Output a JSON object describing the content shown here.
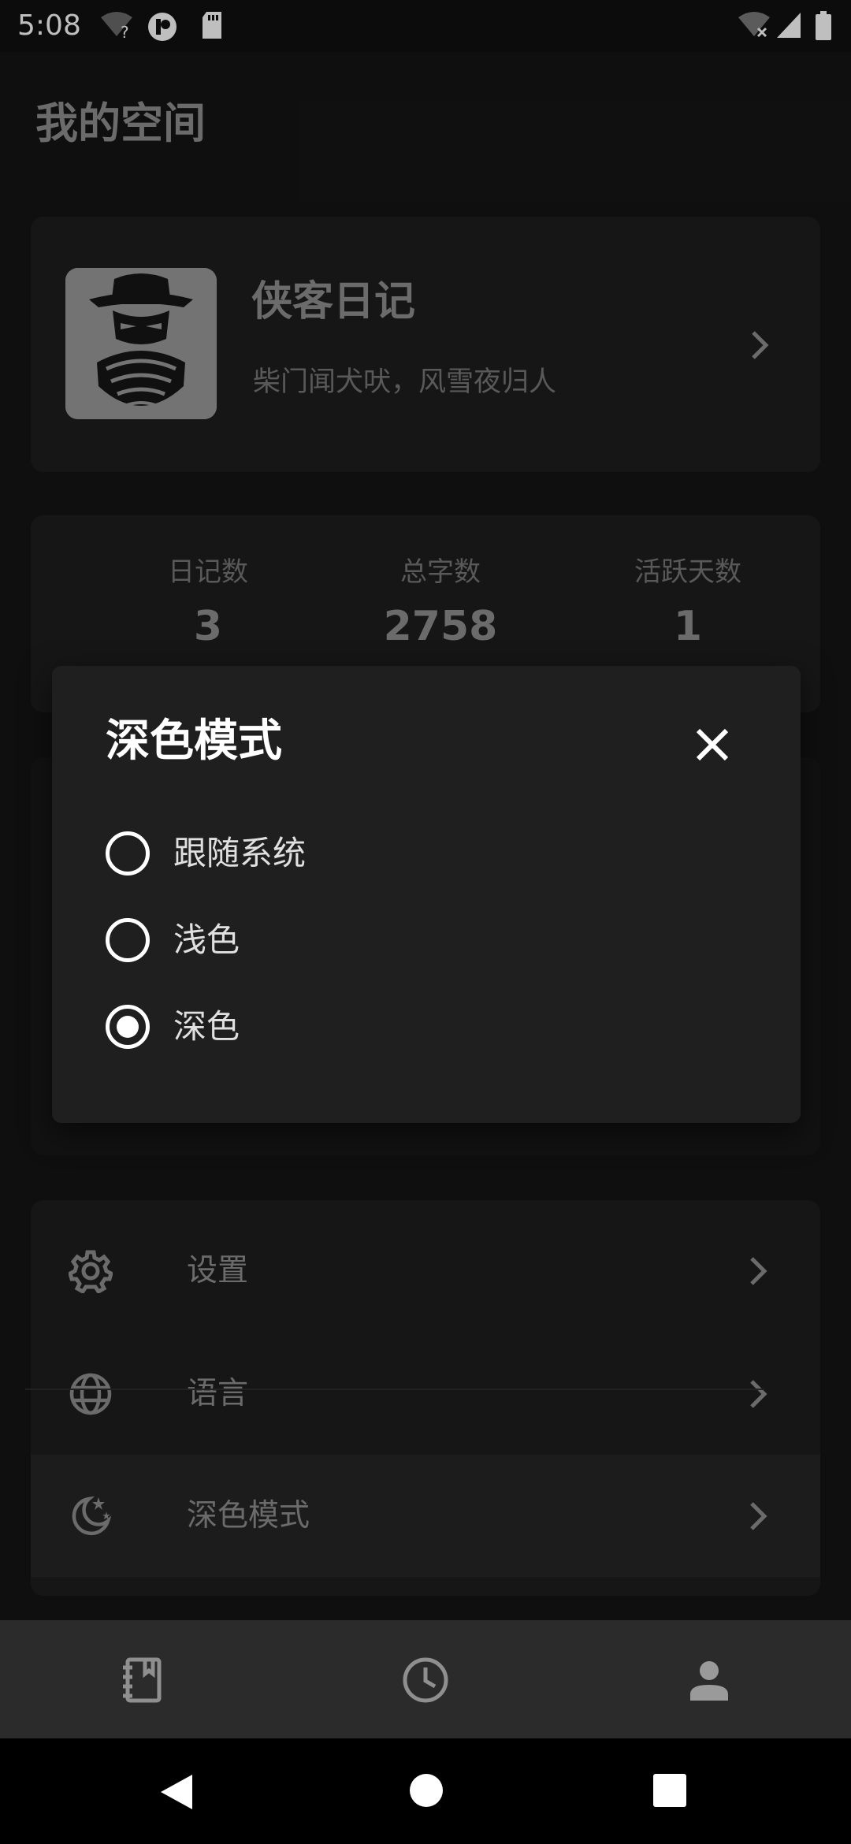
{
  "status_bar": {
    "time": "5:08",
    "left_icons": [
      "wifi-question-icon",
      "app-notification-icon",
      "sd-card-icon"
    ],
    "right_icons": [
      "wifi-off-icon",
      "cell-signal-icon",
      "battery-icon"
    ]
  },
  "page": {
    "title": "我的空间"
  },
  "profile": {
    "name": "侠客日记",
    "motto": "柴门闻犬吠，风雪夜归人",
    "avatar_icon": "masked-hero-avatar"
  },
  "stats": [
    {
      "label": "日记数",
      "value": "3"
    },
    {
      "label": "总字数",
      "value": "2758"
    },
    {
      "label": "活跃天数",
      "value": "1"
    }
  ],
  "menu": [
    {
      "label": "设置",
      "icon": "gear-icon"
    },
    {
      "label": "语言",
      "icon": "globe-icon"
    },
    {
      "label": "深色模式",
      "icon": "moon-stars-icon",
      "highlighted": true
    }
  ],
  "dialog": {
    "title": "深色模式",
    "options": [
      {
        "label": "跟随系统",
        "selected": false
      },
      {
        "label": "浅色",
        "selected": false
      },
      {
        "label": "深色",
        "selected": true
      }
    ]
  },
  "bottom_nav": [
    {
      "icon": "notebook-icon",
      "active": false
    },
    {
      "icon": "clock-icon",
      "active": false
    },
    {
      "icon": "person-icon",
      "active": true
    }
  ],
  "colors": {
    "background": "#151515",
    "card": "#1e1e1e",
    "dialog": "#1f1f1f",
    "text_primary": "#ffffff",
    "text_muted": "#8f8f8f"
  }
}
